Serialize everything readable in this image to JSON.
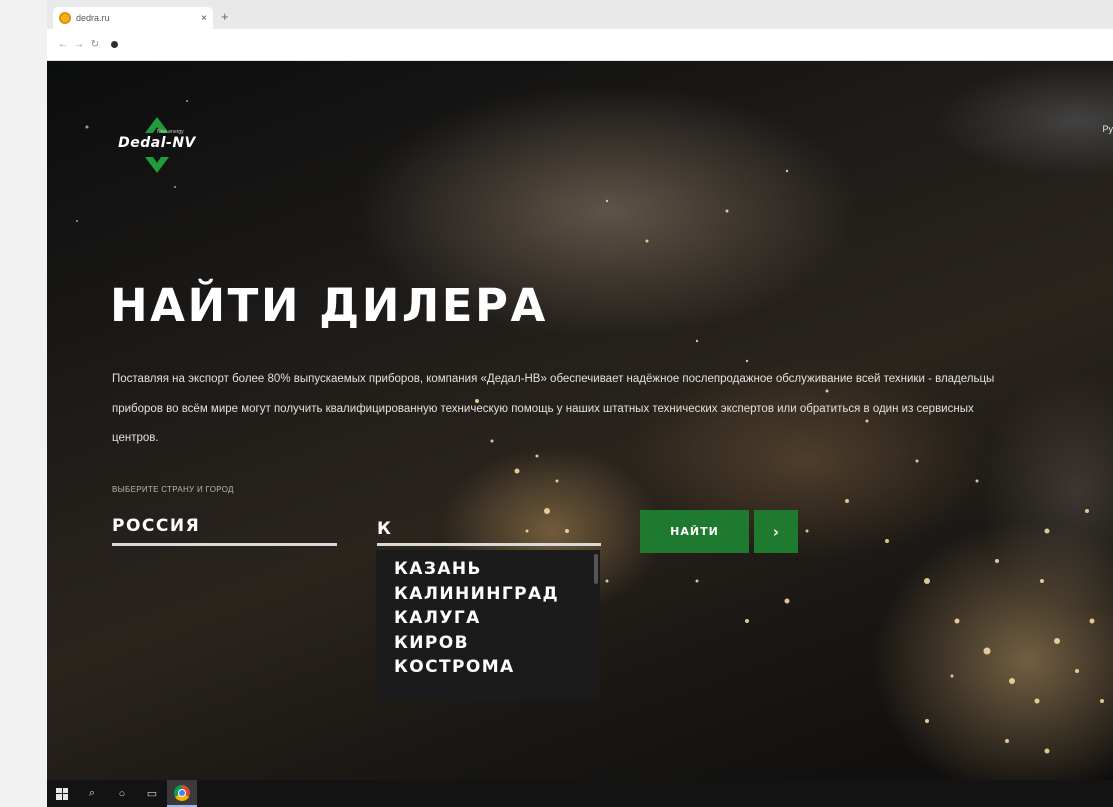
{
  "browser": {
    "tab_title": "dedra.ru",
    "tab_close": "×",
    "new_tab": "+",
    "nav": {
      "back": "←",
      "forward": "→",
      "reload": "↻"
    }
  },
  "header": {
    "logo_text": "Dedal-NV",
    "logo_tagline": "New energy",
    "lang_link": "Ру"
  },
  "hero": {
    "title": "НАЙТИ ДИЛЕРА",
    "description": "Поставляя на экспорт более 80% выпускаемых приборов, компания «Дедал-НВ» обеспечивает надёжное послепродажное обслуживание всей техники - владельцы приборов во всём мире могут получить квалифицированную техническую помощь у наших штатных технических экспертов или обратиться в один из сервисных центров."
  },
  "search_form": {
    "label": "ВЫБЕРИТЕ СТРАНУ И ГОРОД",
    "country_value": "РОССИЯ",
    "city_value": "К",
    "suggestions": [
      "КАЗАНЬ",
      "КАЛИНИНГРАД",
      "КАЛУГА",
      "КИРОВ",
      "КОСТРОМА"
    ],
    "submit_label": "НАЙТИ",
    "arrow_label": "›"
  },
  "taskbar": {
    "icons": [
      "windows-start-icon",
      "search-icon",
      "cortana-icon",
      "task-view-icon",
      "chrome-icon"
    ],
    "search_glyph": "⌕",
    "cortana_glyph": "○",
    "taskview_glyph": "▭"
  },
  "colors": {
    "accent_green": "#1e7a2e",
    "dropdown_bg": "#1b1b1b",
    "page_dark": "#141210"
  }
}
